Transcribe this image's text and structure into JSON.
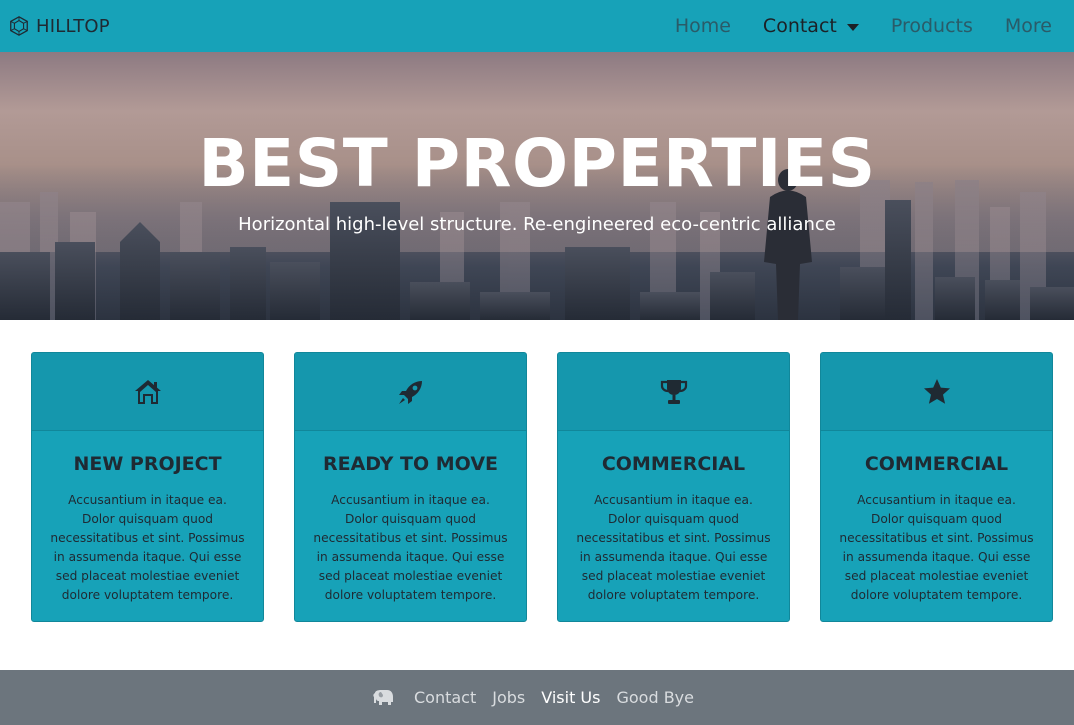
{
  "navbar": {
    "brand": "HILLTOP",
    "brand_icon": "hexagon-logo-icon",
    "items": [
      {
        "label": "Home"
      },
      {
        "label": "Contact"
      },
      {
        "label": "Products"
      },
      {
        "label": "More"
      }
    ]
  },
  "hero": {
    "title": "BEST PROPERTIES",
    "subtitle": "Horizontal high-level structure. Re-engineered eco-centric alliance"
  },
  "cards": [
    {
      "icon": "home-icon",
      "title": "NEW PROJECT",
      "text": "Accusantium in itaque ea. Dolor quisquam quod necessitatibus et sint. Possimus in assumenda itaque. Qui esse sed placeat molestiae eveniet dolore voluptatem tempore."
    },
    {
      "icon": "rocket-icon",
      "title": "READY TO MOVE",
      "text": "Accusantium in itaque ea. Dolor quisquam quod necessitatibus et sint. Possimus in assumenda itaque. Qui esse sed placeat molestiae eveniet dolore voluptatem tempore."
    },
    {
      "icon": "trophy-icon",
      "title": "COMMERCIAL",
      "text": "Accusantium in itaque ea. Dolor quisquam quod necessitatibus et sint. Possimus in assumenda itaque. Qui esse sed placeat molestiae eveniet dolore voluptatem tempore."
    },
    {
      "icon": "star-icon",
      "title": "COMMERCIAL",
      "text": "Accusantium in itaque ea. Dolor quisquam quod necessitatibus et sint. Possimus in assumenda itaque. Qui esse sed placeat molestiae eveniet dolore voluptatem tempore."
    }
  ],
  "footer": {
    "icon": "elephant-icon",
    "links": [
      {
        "label": "Contact"
      },
      {
        "label": "Jobs"
      },
      {
        "label": "Visit Us"
      },
      {
        "label": "Good Bye"
      }
    ]
  },
  "colors": {
    "primary": "#17a2b8",
    "footer": "#6c757d",
    "text_dark": "#1f2a33"
  }
}
